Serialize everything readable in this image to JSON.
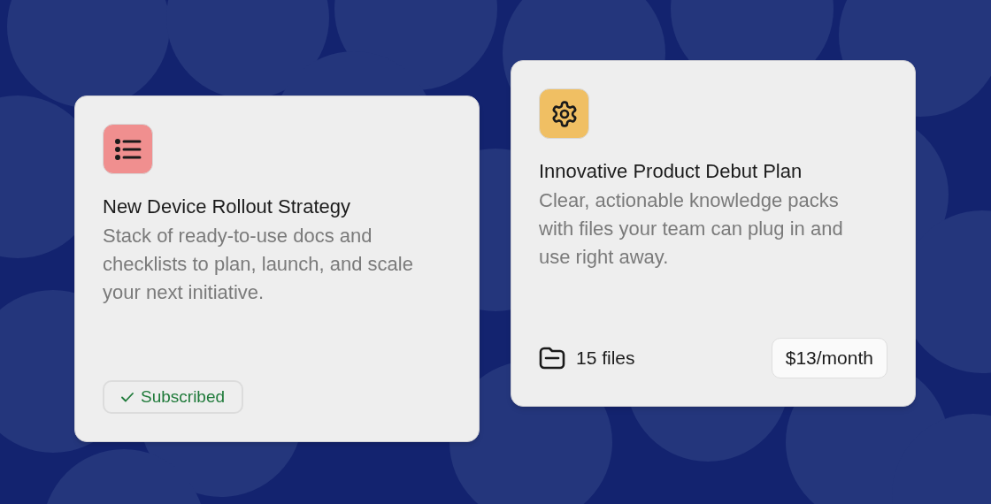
{
  "cards": [
    {
      "icon": {
        "kind": "list",
        "color": "#f08f8f"
      },
      "title": "New Device Rollout Strategy",
      "description": "Stack of ready-to-use docs and checklists to plan, launch, and scale your next initiative.",
      "footer": {
        "kind": "status",
        "label": "Subscribed"
      }
    },
    {
      "icon": {
        "kind": "gear",
        "color": "#f0bf63"
      },
      "title": "Innovative Product Debut Plan",
      "description": "Clear, actionable knowledge packs with files your team can plug in and use right away.",
      "footer": {
        "kind": "pricing",
        "files": "15 files",
        "price": "$13/month"
      }
    }
  ]
}
